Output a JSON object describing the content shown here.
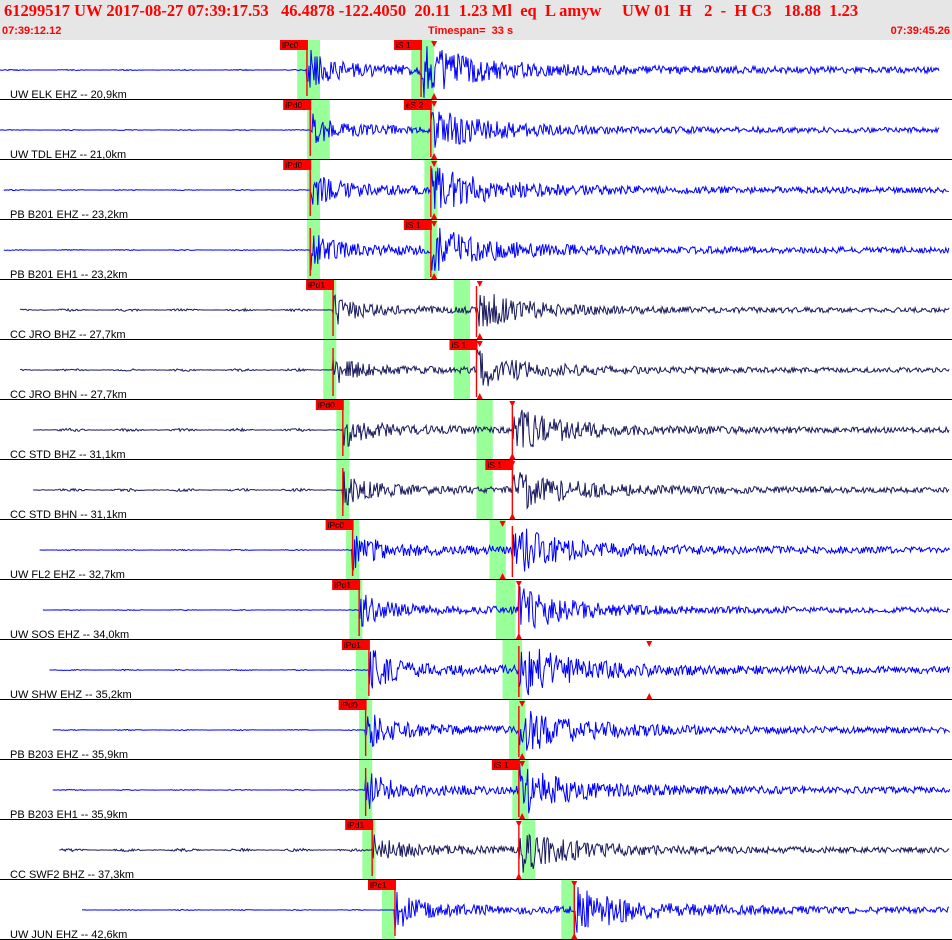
{
  "header": {
    "title": "61299517 UW 2017-08-27 07:39:17.53   46.4878 -122.4050  20.11  1.23 Ml  eq  L amyw     UW 01  H   2  -  H C3   18.88  1.23",
    "start_time": "07:39:12.12",
    "timespan": "Timespan=  33 s",
    "end_time": "07:39:45.26"
  },
  "colors": {
    "header_bg": "#e6e6e6",
    "title": "#ff0000",
    "trace_blue": "#0000ff",
    "trace_dark": "#1a1a60",
    "pick_window": "#99ff99",
    "pick_marker": "#ff0000",
    "grid": "#000000"
  },
  "chart_data": {
    "type": "seismogram",
    "time_start": "07:39:12.12",
    "time_end": "07:39:45.26",
    "timespan_s": 33,
    "channels": [
      {
        "label": "UW ELK EHZ -- 20,9km",
        "color": "#0000ff",
        "start": 0.0,
        "end": 29.0,
        "p_label": "iPc0",
        "p_time": 9.6,
        "p_window": [
          9.3,
          10.0
        ],
        "s_label": "iS 1",
        "s_time": 13.1,
        "s_window": [
          12.8,
          13.5
        ],
        "pick2": 13.5,
        "amp": 1.0
      },
      {
        "label": "UW TDL EHZ -- 21,0km",
        "color": "#0000ff",
        "start": 0.0,
        "end": 29.0,
        "p_label": "iPd0",
        "p_time": 9.7,
        "p_window": [
          9.6,
          10.3
        ],
        "s_label": "eS 2",
        "s_time": 13.4,
        "s_window": [
          12.8,
          13.5
        ],
        "pick2": 13.5,
        "amp": 0.8
      },
      {
        "label": "PB B201 EHZ -- 23,2km",
        "color": "#0000ff",
        "start": 0.3,
        "end": 29.3,
        "p_label": "iPd0",
        "p_time": 9.7,
        "p_window": [
          9.6,
          10.0
        ],
        "s_label": "",
        "s_time": 13.4,
        "s_window": [
          13.2,
          13.6
        ],
        "pick2": 13.5,
        "amp": 0.9
      },
      {
        "label": "PB B201 EH1 -- 23,2km",
        "color": "#0000ff",
        "start": 0.3,
        "end": 29.3,
        "p_label": "",
        "p_time": 9.7,
        "p_window": [
          9.6,
          10.0
        ],
        "s_label": "iS 1",
        "s_time": 13.4,
        "s_window": [
          13.2,
          13.6
        ],
        "pick2": 13.5,
        "amp": 0.9
      },
      {
        "label": "CC JRO BHZ -- 27,7km",
        "color": "#1a1a60",
        "start": 0.8,
        "end": 29.8,
        "p_label": "iPd1",
        "p_time": 10.4,
        "p_window": [
          10.1,
          10.5
        ],
        "s_label": "",
        "s_time": 14.8,
        "s_window": [
          14.1,
          14.6
        ],
        "pick2": 14.9,
        "amp": 0.7
      },
      {
        "label": "CC JRO BHN -- 27,7km",
        "color": "#1a1a60",
        "start": 0.8,
        "end": 29.8,
        "p_label": "",
        "p_time": 10.4,
        "p_window": [
          10.1,
          10.5
        ],
        "s_label": "iS 1",
        "s_time": 14.8,
        "s_window": [
          14.1,
          14.6
        ],
        "pick2": 14.9,
        "amp": 0.7
      },
      {
        "label": "CC STD BHZ -- 31,1km",
        "color": "#1a1a60",
        "start": 1.2,
        "end": 30.2,
        "p_label": "iPd0",
        "p_time": 10.7,
        "p_window": [
          10.5,
          10.9
        ],
        "s_label": "",
        "s_time": 15.9,
        "s_window": [
          14.8,
          15.3
        ],
        "pick2": 15.9,
        "amp": 0.8
      },
      {
        "label": "CC STD BHN -- 31,1km",
        "color": "#1a1a60",
        "start": 1.2,
        "end": 30.2,
        "p_label": "",
        "p_time": 10.7,
        "p_window": [
          10.5,
          10.9
        ],
        "s_label": "iS 1",
        "s_time": 15.9,
        "s_window": [
          14.8,
          15.3
        ],
        "pick2": 15.9,
        "amp": 0.8
      },
      {
        "label": "UW FL2 EHZ -- 32,7km",
        "color": "#0000ff",
        "start": 1.4,
        "end": 30.4,
        "p_label": "iPc0",
        "p_time": 11.0,
        "p_window": [
          10.8,
          11.2
        ],
        "s_label": "",
        "s_time": 15.9,
        "s_window": [
          15.2,
          15.7
        ],
        "pick2": 15.6,
        "amp": 0.9
      },
      {
        "label": "UW SOS EHZ -- 34,0km",
        "color": "#0000ff",
        "start": 1.5,
        "end": 30.5,
        "p_label": "iPd1",
        "p_time": 11.2,
        "p_window": [
          10.9,
          11.3
        ],
        "s_label": "",
        "s_time": 16.1,
        "s_window": [
          15.4,
          16.0
        ],
        "pick2": 16.1,
        "amp": 0.8
      },
      {
        "label": "UW SHW EHZ -- 35,2km",
        "color": "#0000ff",
        "start": 1.7,
        "end": 30.7,
        "p_label": "iPd1",
        "p_time": 11.5,
        "p_window": [
          11.1,
          11.5
        ],
        "s_label": "",
        "s_time": 16.1,
        "s_window": [
          15.6,
          16.2
        ],
        "pick2": 20.1,
        "amp": 1.0
      },
      {
        "label": "PB B203 EHZ -- 35,9km",
        "color": "#0000ff",
        "start": 1.8,
        "end": 30.8,
        "p_label": "iPd0",
        "p_time": 11.4,
        "p_window": [
          11.2,
          11.6
        ],
        "s_label": "",
        "s_time": 16.1,
        "s_window": [
          15.8,
          16.3
        ],
        "pick2": 16.2,
        "amp": 0.9
      },
      {
        "label": "PB B203 EH1 -- 35,9km",
        "color": "#0000ff",
        "start": 1.8,
        "end": 30.8,
        "p_label": "",
        "p_time": 11.4,
        "p_window": [
          11.2,
          11.6
        ],
        "s_label": "iS 1",
        "s_time": 16.1,
        "s_window": [
          15.9,
          16.4
        ],
        "pick2": 16.2,
        "amp": 0.9
      },
      {
        "label": "CC SWF2 BHZ -- 37,3km",
        "color": "#1a1a60",
        "start": 2.0,
        "end": 31.0,
        "p_label": "iPd1",
        "p_time": 11.6,
        "p_window": [
          11.3,
          11.7
        ],
        "s_label": "",
        "s_time": 16.1,
        "s_window": [
          16.2,
          16.6
        ],
        "pick2": 16.1,
        "amp": 0.8
      },
      {
        "label": "UW JUN EHZ -- 42,6km",
        "color": "#0000ff",
        "start": 2.7,
        "end": 31.5,
        "p_label": "iPc1",
        "p_time": 12.3,
        "p_window": [
          11.9,
          12.3
        ],
        "s_label": "",
        "s_time": 17.8,
        "s_window": [
          17.4,
          17.8
        ],
        "pick2": 17.8,
        "amp": 0.9
      }
    ]
  }
}
